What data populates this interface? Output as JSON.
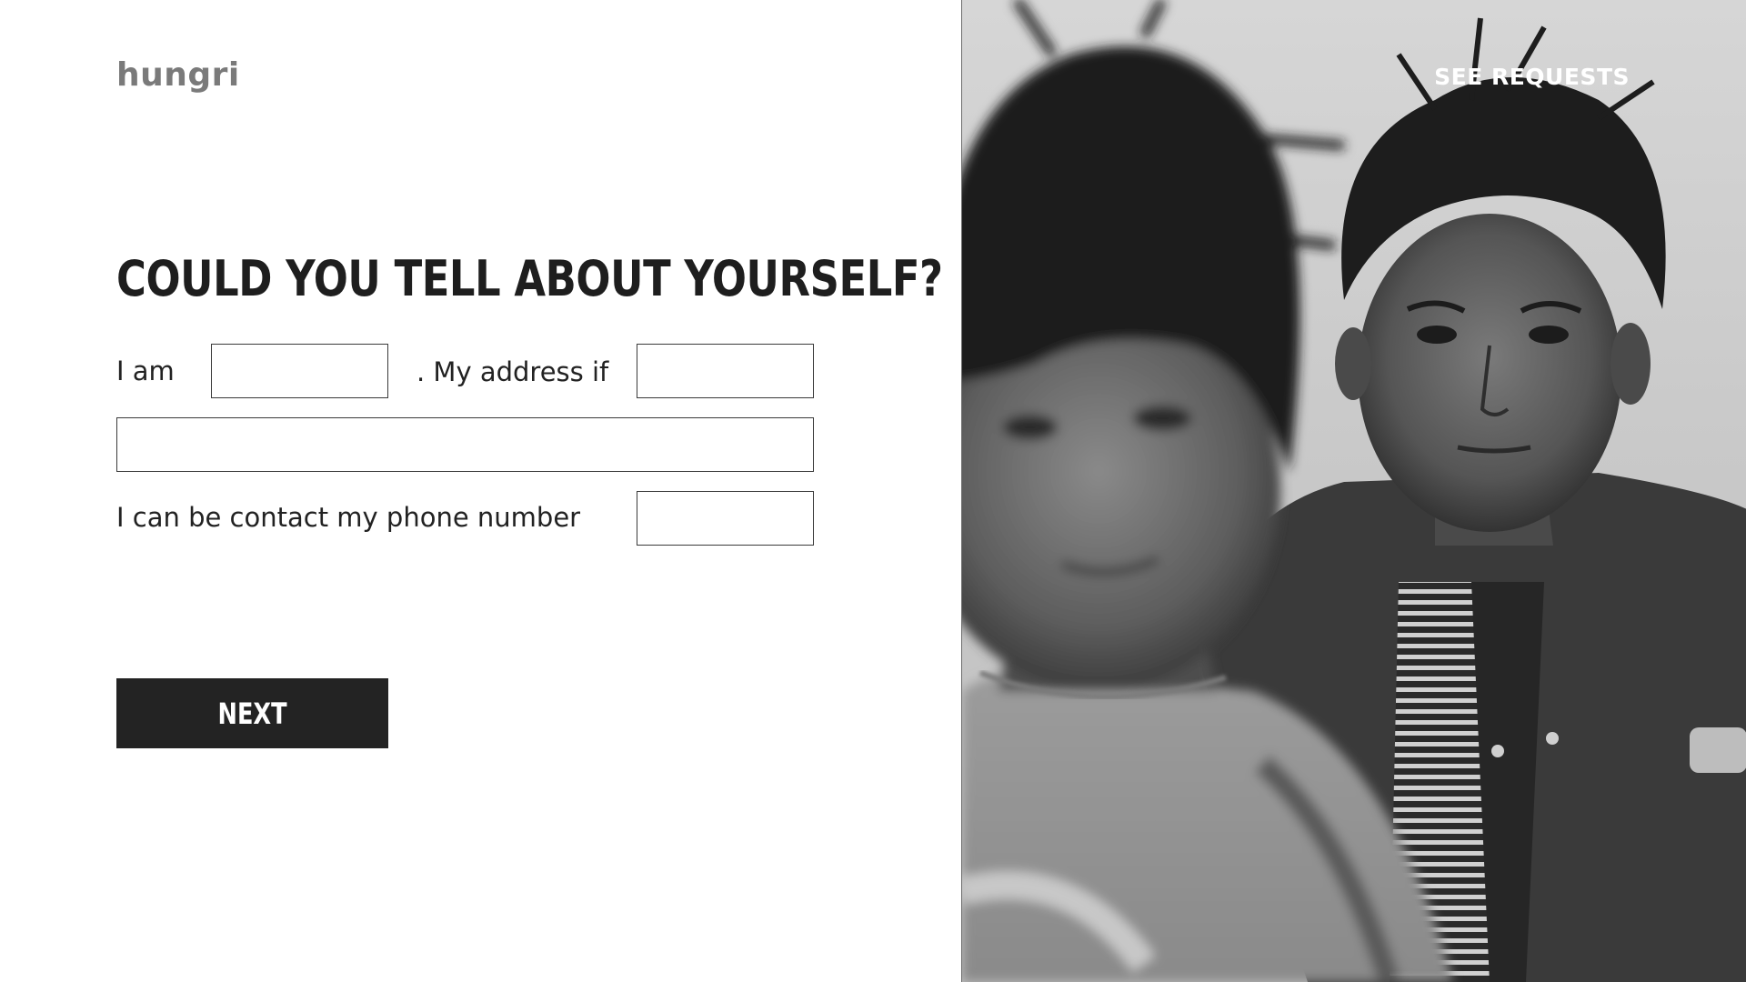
{
  "brand": {
    "logo_text": "hungri"
  },
  "nav": {
    "see_requests_label": "SEE REQUESTS"
  },
  "form": {
    "headline": "COULD YOU TELL ABOUT YOURSELF?",
    "name_label": "I am",
    "name_value": "",
    "address_label": ". My address if",
    "address_value_short": "",
    "address_value_full": "",
    "phone_label": "I can be contact my phone number",
    "phone_value": ""
  },
  "actions": {
    "next_label": "NEXT"
  },
  "hero_image": {
    "description_icon": "photo-two-children-monochrome"
  },
  "colors": {
    "primary_text": "#1e1e1e",
    "logo": "#7a7a7a",
    "button_bg": "#232323",
    "button_text": "#ffffff",
    "nav_link": "#ffffff"
  }
}
